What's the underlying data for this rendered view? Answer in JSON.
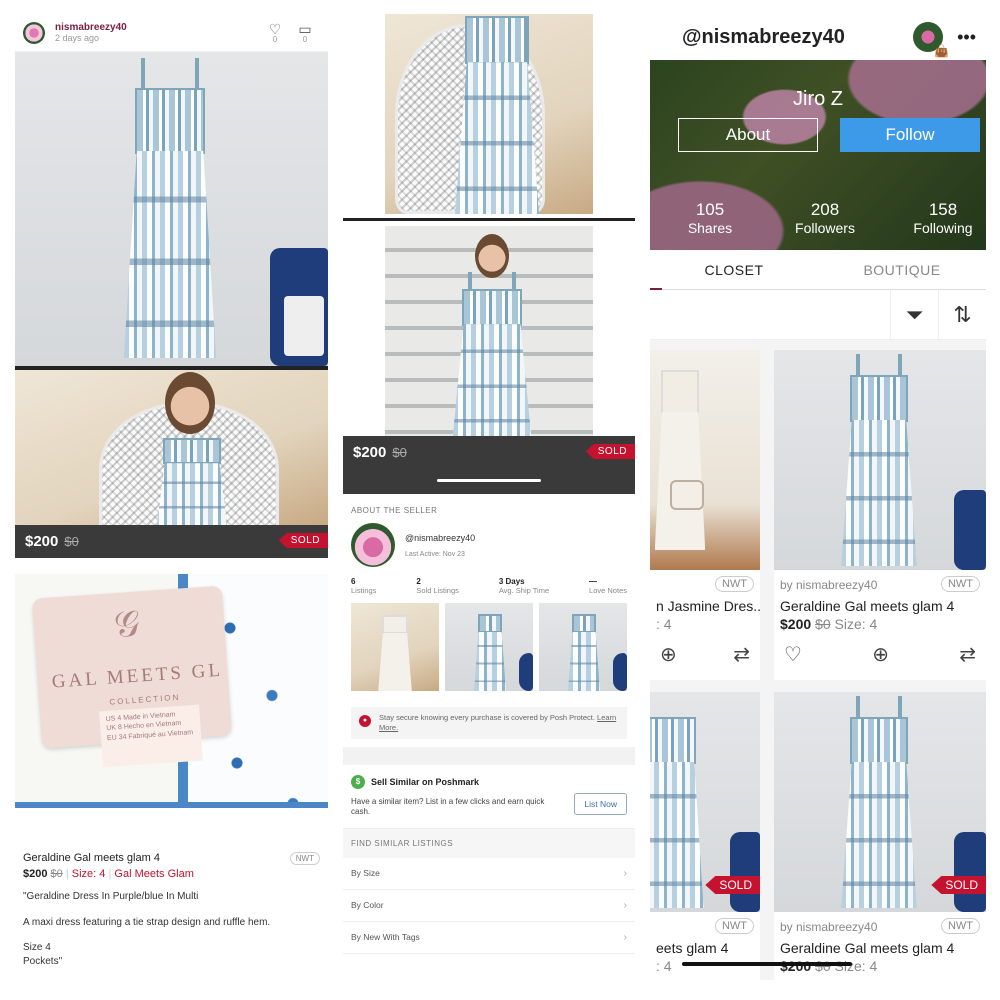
{
  "post": {
    "username": "nismabreezy40",
    "time": "2 days ago",
    "like_count": "0",
    "comment_count": "0",
    "price": "$200",
    "original_price": "$0",
    "sold": "SOLD"
  },
  "label": {
    "brand": "GAL MEETS GL",
    "collection": "COLLECTION",
    "size_lines": "US 4  Made in Vietnam\nUK 8  Hecho en Vietnam\nEU 34  Fabriqué au Vietnam"
  },
  "listing": {
    "title": "Geraldine Gal meets glam 4",
    "nwt": "NWT",
    "price": "$200",
    "original_price": "$0",
    "size": "Size: 4",
    "brand": "Gal Meets Glam",
    "description_1": "\"Geraldine Dress In Purple/blue In Multi",
    "description_2": "A maxi dress featuring a tie strap design and ruffle hem.",
    "description_3": "Size 4",
    "description_4": "Pockets\""
  },
  "middle": {
    "price": "$200",
    "original_price": "$0",
    "sold": "SOLD",
    "about_seller": "ABOUT THE SELLER",
    "seller_handle": "@nismabreezy40",
    "last_active": "Last Active: Nov 23",
    "stats": [
      {
        "value": "6",
        "label": "Listings"
      },
      {
        "value": "2",
        "label": "Sold Listings"
      },
      {
        "value": "3 Days",
        "label": "Avg. Ship Time"
      },
      {
        "value": "—",
        "label": "Love Notes"
      }
    ],
    "protect_text": "Stay secure knowing every purchase is covered by Posh Protect.",
    "protect_link": "Learn More.",
    "sell_similar_title": "Sell Similar on Poshmark",
    "sell_similar_desc": "Have a similar item? List in a few clicks and earn quick cash.",
    "list_now": "List Now",
    "find_similar": "FIND SIMILAR LISTINGS",
    "filters": [
      "By Size",
      "By Color",
      "By New With Tags"
    ]
  },
  "profile": {
    "handle": "@nismabreezy40",
    "name": "Jiro Z",
    "about": "About",
    "follow": "Follow",
    "shares_count": "105",
    "shares_label": "Shares",
    "followers_count": "208",
    "followers_label": "Followers",
    "following_count": "158",
    "following_label": "Following",
    "tab_closet": "CLOSET",
    "tab_boutique": "BOUTIQUE",
    "cards": [
      {
        "by": "",
        "nwt": "NWT",
        "title": "n Jasmine Dres...",
        "price_line": ": 4",
        "sold": ""
      },
      {
        "by": "by nismabreezy40",
        "nwt": "NWT",
        "title": "Geraldine Gal meets glam 4",
        "price": "$200",
        "orig": "$0",
        "size": "Size: 4",
        "sold": ""
      },
      {
        "by": "",
        "nwt": "NWT",
        "title": "eets glam 4",
        "price_line": ": 4",
        "sold": "SOLD"
      },
      {
        "by": "by nismabreezy40",
        "nwt": "NWT",
        "title": "Geraldine Gal meets glam 4",
        "price": "$200",
        "orig": "$0",
        "size": "Size: 4",
        "sold": "SOLD"
      }
    ]
  },
  "icons": {
    "heart": "heart-icon",
    "comment": "comment-icon",
    "filter": "filter-icon",
    "sort": "sort-icon",
    "share": "share-icon",
    "bag": "bag-icon",
    "more": "more-icon"
  },
  "colors": {
    "sold_red": "#c4122f",
    "follow_blue": "#3c9ae8",
    "brand_maroon": "#7a1f3d",
    "price_bar": "#3a3a3a"
  }
}
